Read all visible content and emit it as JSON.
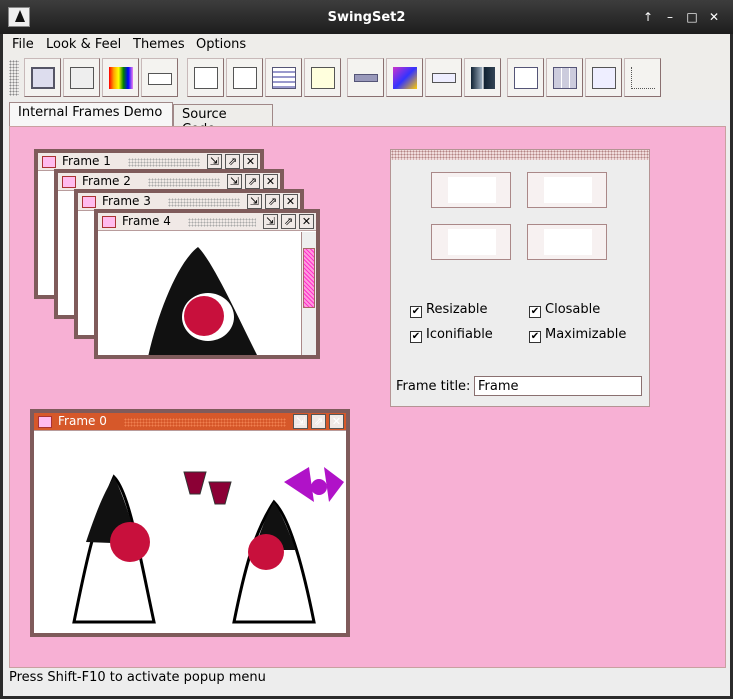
{
  "window": {
    "title": "SwingSet2",
    "controls": [
      "↑",
      "–",
      "□",
      "✕"
    ]
  },
  "menubar": {
    "items": [
      "File",
      "Look & Feel",
      "Themes",
      "Options"
    ]
  },
  "toolbar": {
    "buttons": [
      "internal-frames-icon",
      "buttons-icon",
      "color-chooser-icon",
      "combobox-icon",
      "file-chooser-icon",
      "html-icon",
      "list-icon",
      "optionpane-icon",
      "progressbar-icon",
      "scrollpane-icon",
      "slider-icon",
      "splitpane-icon",
      "tabbedpane-icon",
      "table-icon",
      "tooltip-icon",
      "tree-icon"
    ]
  },
  "tabs": {
    "items": [
      "Internal Frames Demo",
      "Source Code"
    ],
    "selected": "Internal Frames Demo"
  },
  "frames": {
    "f1": "Frame 1",
    "f2": "Frame 2",
    "f3": "Frame 3",
    "f4": "Frame 4",
    "f0": "Frame 0"
  },
  "panel": {
    "options": {
      "resizable": "Resizable",
      "closable": "Closable",
      "iconifiable": "Iconifiable",
      "maximizable": "Maximizable"
    },
    "checked": {
      "resizable": true,
      "closable": true,
      "iconifiable": true,
      "maximizable": true
    },
    "frame_title_label": "Frame title:",
    "frame_title_value": "Frame"
  },
  "status": "Press Shift-F10 to activate popup menu",
  "colors": {
    "desktop": "#f7b0d4",
    "frame_border": "#7f5b5b",
    "active_title": "#d6582a"
  }
}
